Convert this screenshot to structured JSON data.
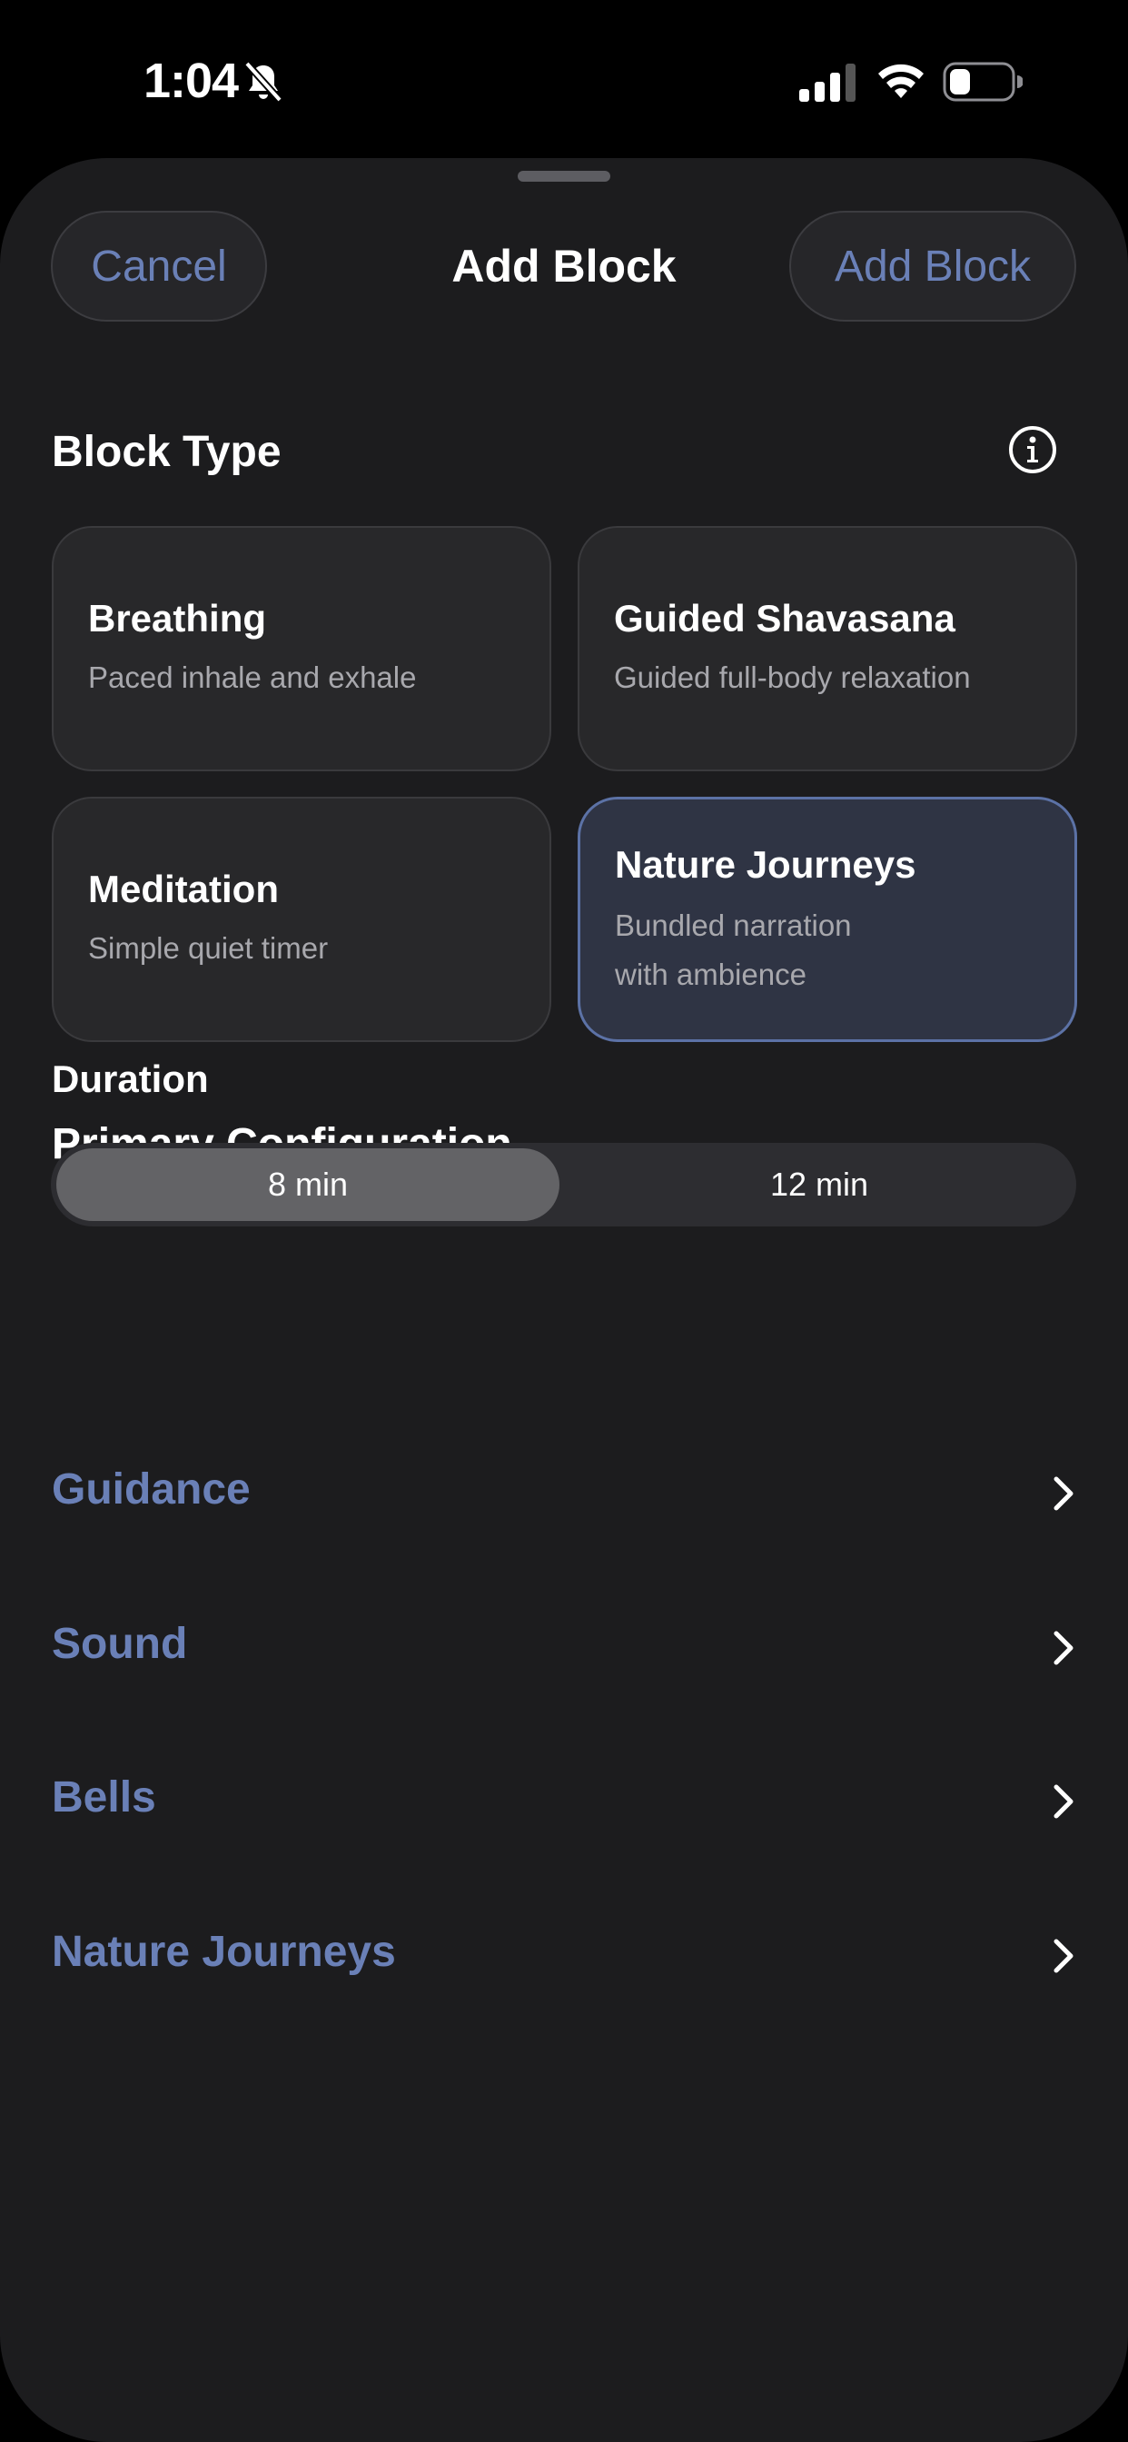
{
  "status_bar": {
    "time": "1:04"
  },
  "nav": {
    "cancel_label": "Cancel",
    "title": "Add Block",
    "add_label": "Add Block"
  },
  "block_type": {
    "heading": "Block Type",
    "info_icon": "info-circle-icon",
    "options": [
      {
        "title": "Breathing",
        "subtitle": "Paced inhale and exhale",
        "selected": false
      },
      {
        "title": "Guided Shavasana",
        "subtitle": "Guided full-body relaxation",
        "selected": false
      },
      {
        "title": "Meditation",
        "subtitle": "Simple quiet timer",
        "selected": false
      },
      {
        "title": "Nature Journeys",
        "subtitle_line1": "Bundled narration",
        "subtitle_line2": "with ambience",
        "selected": true
      }
    ]
  },
  "primary_config": {
    "heading": "Primary Configuration",
    "duration_label": "Duration",
    "duration_options": [
      "8 min",
      "12 min"
    ],
    "duration_selected": "8 min"
  },
  "links": [
    {
      "label": "Guidance"
    },
    {
      "label": "Sound"
    },
    {
      "label": "Bells"
    },
    {
      "label": "Nature Journeys"
    }
  ],
  "colors": {
    "accent": "#6a80b7",
    "sheet_bg": "#1c1c1e",
    "selected_card_bg": "#2f3444",
    "selected_card_border": "#5c72a6"
  }
}
